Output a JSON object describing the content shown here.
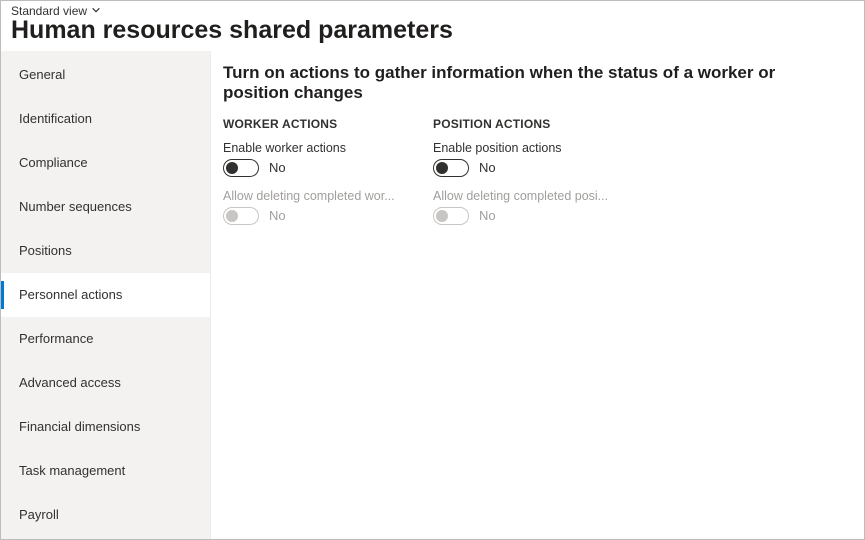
{
  "header": {
    "view_label": "Standard view",
    "page_title": "Human resources shared parameters"
  },
  "sidebar": {
    "items": [
      {
        "label": "General",
        "active": false
      },
      {
        "label": "Identification",
        "active": false
      },
      {
        "label": "Compliance",
        "active": false
      },
      {
        "label": "Number sequences",
        "active": false
      },
      {
        "label": "Positions",
        "active": false
      },
      {
        "label": "Personnel actions",
        "active": true
      },
      {
        "label": "Performance",
        "active": false
      },
      {
        "label": "Advanced access",
        "active": false
      },
      {
        "label": "Financial dimensions",
        "active": false
      },
      {
        "label": "Task management",
        "active": false
      },
      {
        "label": "Payroll",
        "active": false
      }
    ]
  },
  "main": {
    "heading": "Turn on actions to gather information when the status of a worker or position changes",
    "worker": {
      "section_label": "WORKER ACTIONS",
      "enable_label": "Enable worker actions",
      "enable_value": "No",
      "allow_delete_label": "Allow deleting completed wor...",
      "allow_delete_value": "No"
    },
    "position": {
      "section_label": "POSITION ACTIONS",
      "enable_label": "Enable position actions",
      "enable_value": "No",
      "allow_delete_label": "Allow deleting completed posi...",
      "allow_delete_value": "No"
    }
  }
}
